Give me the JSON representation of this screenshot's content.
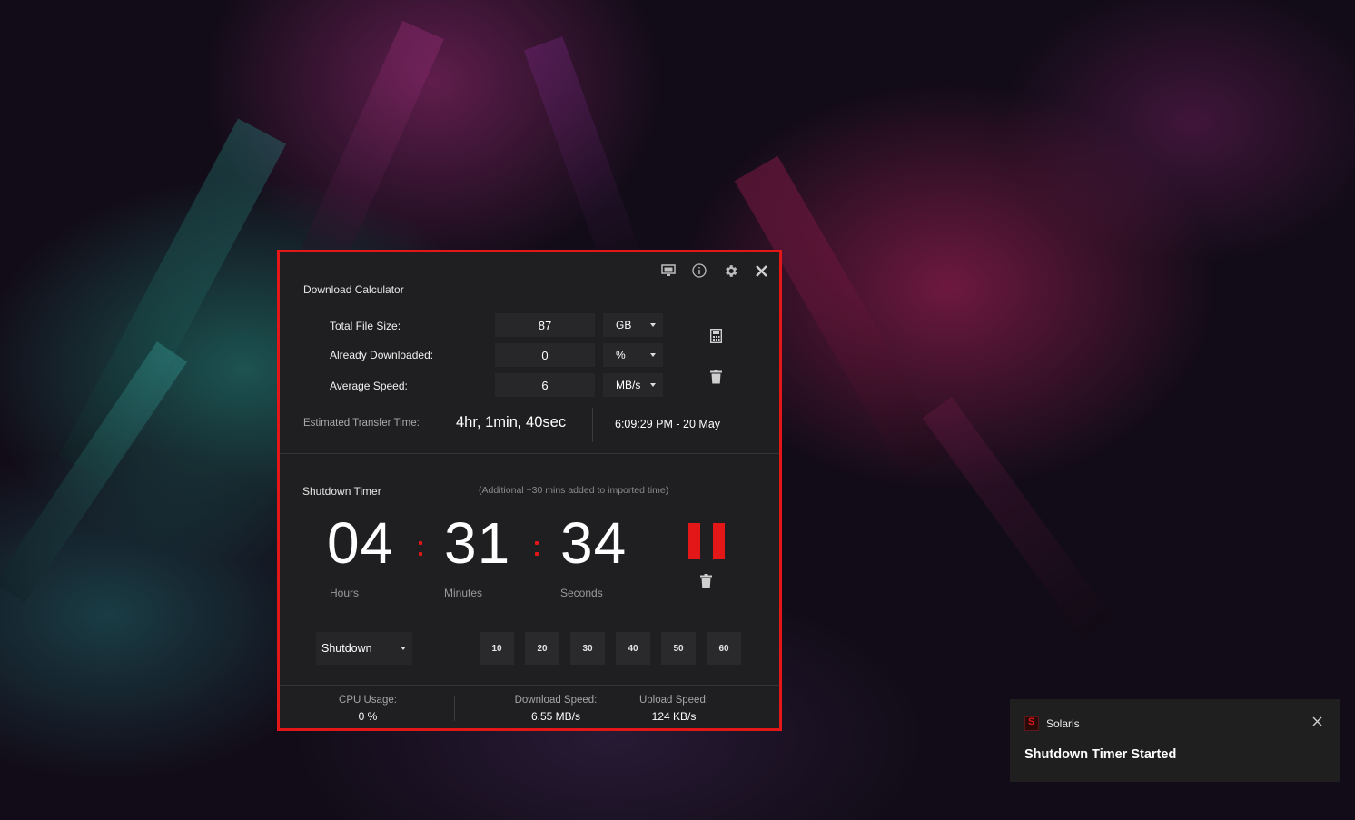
{
  "window": {
    "calculator_title": "Download Calculator",
    "fields": [
      {
        "label": "Total File Size:",
        "value": "87",
        "unit": "GB"
      },
      {
        "label": "Already Downloaded:",
        "value": "0",
        "unit": "%"
      },
      {
        "label": "Average Speed:",
        "value": "6",
        "unit": "MB/s"
      }
    ],
    "estimate_label": "Estimated Transfer Time:",
    "estimate_value": "4hr, 1min, 40sec",
    "estimate_date": "6:09:29 PM - 20 May",
    "timer_title": "Shutdown Timer",
    "timer_note": "(Additional +30 mins added to imported time)",
    "timer": {
      "hours": "04",
      "minutes": "31",
      "seconds": "34",
      "hours_label": "Hours",
      "minutes_label": "Minutes",
      "seconds_label": "Seconds"
    },
    "action_select": "Shutdown",
    "quick_minutes": [
      "10",
      "20",
      "30",
      "40",
      "50",
      "60"
    ],
    "stats": {
      "cpu_label": "CPU Usage:",
      "cpu_value": "0 %",
      "download_label": "Download Speed:",
      "download_value": "6.55 MB/s",
      "upload_label": "Upload Speed:",
      "upload_value": "124 KB/s"
    },
    "icons": [
      "monitor-icon",
      "info-icon",
      "gear-icon",
      "close-icon",
      "calculator-icon",
      "trash-icon",
      "pause-icon"
    ],
    "accent_color": "#e31717"
  },
  "toast": {
    "app_name": "Solaris",
    "message": "Shutdown Timer Started",
    "icons": [
      "solaris-app-icon",
      "close-icon"
    ]
  }
}
